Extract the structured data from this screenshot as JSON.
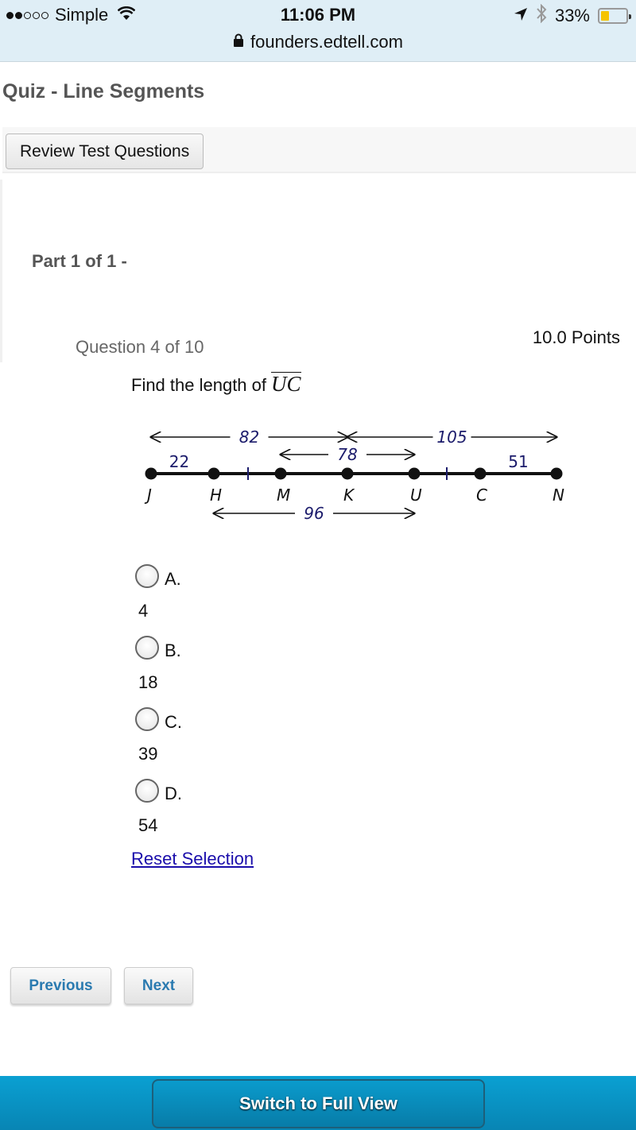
{
  "status_bar": {
    "carrier": "Simple",
    "signal_bars_filled": 2,
    "signal_bars_total": 5,
    "time": "11:06 PM",
    "battery_percent_label": "33%",
    "battery_level": 0.33,
    "battery_color": "#f5c400",
    "icons": [
      "wifi-icon",
      "location-arrow-icon",
      "bluetooth-icon",
      "battery-icon",
      "lock-icon"
    ]
  },
  "browser": {
    "url": "founders.edtell.com"
  },
  "page": {
    "title": "Quiz - Line Segments",
    "review_button": "Review Test Questions",
    "part_label": "Part 1 of 1 -"
  },
  "question": {
    "number_label": "Question 4 of 10",
    "points_label": "10.0 Points",
    "prompt_text": "Find the length of",
    "segment": "UC"
  },
  "figure": {
    "points": [
      "J",
      "H",
      "M",
      "K",
      "U",
      "C",
      "N"
    ],
    "segment_labels": {
      "JH": "22",
      "CN": "51",
      "JK": "82",
      "KN": "105",
      "MU": "78",
      "HU": "96"
    },
    "label_color": "#1b1b6b"
  },
  "choices": [
    {
      "letter": "A.",
      "value": "4"
    },
    {
      "letter": "B.",
      "value": "18"
    },
    {
      "letter": "C.",
      "value": "39"
    },
    {
      "letter": "D.",
      "value": "54"
    }
  ],
  "reset_link": "Reset Selection",
  "nav": {
    "previous": "Previous",
    "next": "Next",
    "button_text_color": "#2a7ab0"
  },
  "footer": {
    "switch_button": "Switch to Full View",
    "background_color": "#0a98c9"
  }
}
